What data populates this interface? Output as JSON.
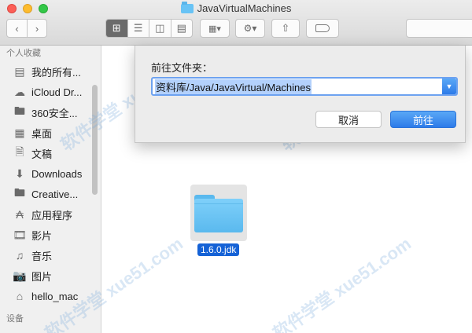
{
  "window": {
    "title": "JavaVirtualMachines"
  },
  "toolbar": {
    "back_icon": "chevron-left-icon",
    "forward_icon": "chevron-right-icon",
    "views": [
      "icon-view",
      "list-view",
      "column-view",
      "cover-flow-view"
    ],
    "arrange_icon": "arrange-icon",
    "action_icon": "gear-icon",
    "share_icon": "share-icon",
    "tag_icon": "tag-icon"
  },
  "sidebar": {
    "favorites_heading": "个人收藏",
    "items": [
      {
        "label": "我的所有...",
        "icon": "all-files-icon"
      },
      {
        "label": "iCloud Dr...",
        "icon": "cloud-icon"
      },
      {
        "label": "360安全...",
        "icon": "folder-icon"
      },
      {
        "label": "桌面",
        "icon": "desktop-icon"
      },
      {
        "label": "文稿",
        "icon": "documents-icon"
      },
      {
        "label": "Downloads",
        "icon": "download-icon"
      },
      {
        "label": "Creative...",
        "icon": "folder-icon"
      },
      {
        "label": "应用程序",
        "icon": "applications-icon"
      },
      {
        "label": "影片",
        "icon": "movies-icon"
      },
      {
        "label": "音乐",
        "icon": "music-icon"
      },
      {
        "label": "图片",
        "icon": "camera-icon"
      },
      {
        "label": "hello_mac",
        "icon": "home-icon"
      }
    ],
    "devices_heading": "设备"
  },
  "sheet": {
    "prompt": "前往文件夹：",
    "path_value": "资料库/Java/JavaVirtual/Machines",
    "cancel_label": "取消",
    "go_label": "前往"
  },
  "content": {
    "file_name": "1.6.0.jdk"
  },
  "watermark": "软件学堂 xue51.com",
  "colors": {
    "accent": "#2d7be9",
    "folder": "#68c3f5",
    "selection": "#1562d6"
  }
}
